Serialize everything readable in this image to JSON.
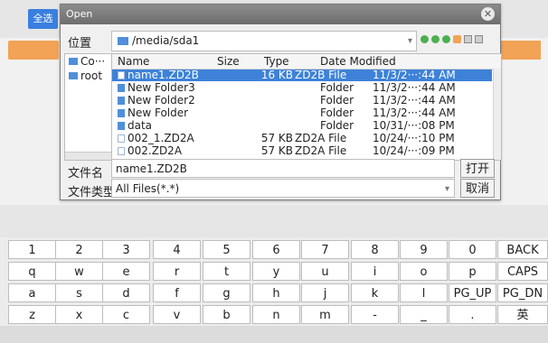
{
  "app": {
    "select_all_label": "全选"
  },
  "dialog": {
    "title": "Open",
    "close_icon": "close-icon",
    "location_label": "位置",
    "path": "/media/sda1",
    "tree": [
      {
        "label": "Co···"
      },
      {
        "label": "root"
      }
    ],
    "columns": {
      "name": "Name",
      "size": "Size",
      "type": "Type",
      "date": "Date Modified"
    },
    "files": [
      {
        "name": "name1.ZD2B",
        "size": "16 KB",
        "type": "ZD2B File",
        "date": "11/3/2···:44 AM",
        "kind": "file",
        "selected": true
      },
      {
        "name": "New Folder3",
        "size": "",
        "type": "Folder",
        "date": "11/3/2···:44 AM",
        "kind": "folder"
      },
      {
        "name": "New Folder2",
        "size": "",
        "type": "Folder",
        "date": "11/3/2···:44 AM",
        "kind": "folder"
      },
      {
        "name": "New Folder",
        "size": "",
        "type": "Folder",
        "date": "11/3/2···:44 AM",
        "kind": "folder"
      },
      {
        "name": "data",
        "size": "",
        "type": "Folder",
        "date": "10/31/···:08 PM",
        "kind": "folder"
      },
      {
        "name": "002_1.ZD2A",
        "size": "57 KB",
        "type": "ZD2A File",
        "date": "10/24/···:10 PM",
        "kind": "file"
      },
      {
        "name": "002.ZD2A",
        "size": "57 KB",
        "type": "ZD2A File",
        "date": "10/24/···:09 PM",
        "kind": "file"
      }
    ],
    "filename_label": "文件名",
    "filename_value": "name1.ZD2B",
    "open_label": "打开",
    "filetype_label": "文件类型",
    "filetype_value": "All Files(*.*)",
    "cancel_label": "取消"
  },
  "keyboard": {
    "rows": [
      [
        "1",
        "2",
        "3",
        "4",
        "5",
        "6",
        "7",
        "8",
        "9",
        "0",
        "BACK"
      ],
      [
        "q",
        "w",
        "e",
        "r",
        "t",
        "y",
        "u",
        "i",
        "o",
        "p",
        "CAPS"
      ],
      [
        "a",
        "s",
        "d",
        "f",
        "g",
        "h",
        "j",
        "k",
        "l",
        "PG_UP",
        "PG_DN"
      ],
      [
        "z",
        "x",
        "c",
        "v",
        "b",
        "n",
        "m",
        "-",
        "_",
        ".",
        "英"
      ]
    ]
  }
}
